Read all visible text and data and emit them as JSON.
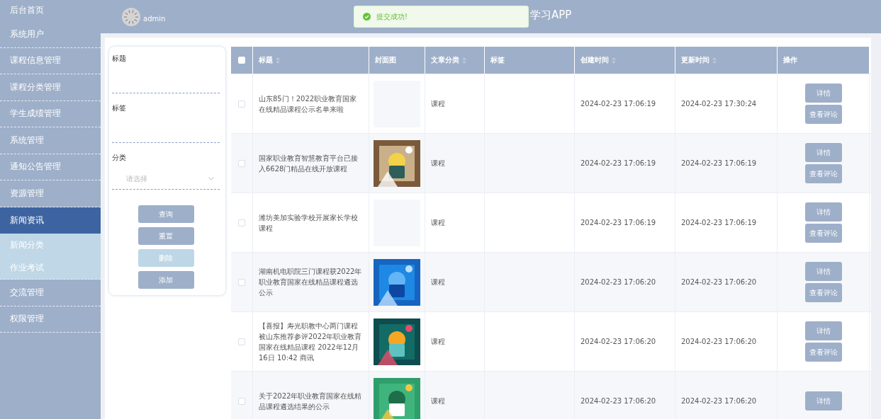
{
  "sidebar": {
    "items": [
      {
        "label": "后台首页",
        "selected": false
      },
      {
        "label": "系统用户",
        "selected": false
      },
      {
        "label": "课程信息管理",
        "selected": false
      },
      {
        "label": "课程分类管理",
        "selected": false
      },
      {
        "label": "学生成绩管理",
        "selected": false
      },
      {
        "label": "系统管理",
        "selected": false
      },
      {
        "label": "通知公告管理",
        "selected": false
      },
      {
        "label": "资源管理",
        "selected": false
      },
      {
        "label": "新闻资讯",
        "selected": true,
        "expanded": true,
        "children": [
          {
            "label": "新闻分类",
            "selected": false
          },
          {
            "label": "作业考试",
            "selected": false
          }
        ]
      },
      {
        "label": "交流管理",
        "selected": false
      },
      {
        "label": "权限管理",
        "selected": false
      }
    ]
  },
  "header": {
    "user": "admin",
    "title": "学习APP"
  },
  "toast": {
    "text": "提交成功!"
  },
  "filter": {
    "fields": [
      {
        "kind": "input",
        "label": "标题"
      },
      {
        "kind": "input",
        "label": "标签"
      },
      {
        "kind": "select",
        "label": "分类",
        "placeholder": "请选择"
      }
    ],
    "buttons": [
      {
        "label": "查询",
        "disabled": false
      },
      {
        "label": "重置",
        "disabled": false
      },
      {
        "label": "删除",
        "disabled": true
      },
      {
        "label": "添加",
        "disabled": false
      }
    ]
  },
  "table": {
    "select_all": {
      "checked": false
    },
    "columns": [
      {
        "label": "标题",
        "sortable": true
      },
      {
        "label": "封面图",
        "sortable": false
      },
      {
        "label": "文章分类",
        "sortable": true
      },
      {
        "label": "标签",
        "sortable": false
      },
      {
        "label": "创建时间",
        "sortable": true
      },
      {
        "label": "更新时间",
        "sortable": true
      },
      {
        "label": "操作",
        "sortable": false
      }
    ],
    "rows": [
      {
        "checked": false,
        "title": "山东85门！2022职业教育国家在线精品课程公示名单来啦",
        "cover": {
          "kind": "empty"
        },
        "category": "课程",
        "created": "2024-02-23 17:06:19",
        "updated": "2024-02-23 17:30:24",
        "actions": [
          "详情",
          "查看评论"
        ]
      },
      {
        "checked": false,
        "title": "国家职业教育智慧教育平台已接入6628门精品在线开放课程",
        "cover": {
          "kind": "picture"
        },
        "category": "课程",
        "created": "2024-02-23 17:06:19",
        "updated": "2024-02-23 17:06:19",
        "actions": [
          "详情",
          "查看评论"
        ]
      },
      {
        "checked": false,
        "title": "潍坊美加实验学校开展家长学校课程",
        "cover": {
          "kind": "empty"
        },
        "category": "课程",
        "created": "2024-02-23 17:06:19",
        "updated": "2024-02-23 17:06:19",
        "actions": [
          "详情",
          "查看评论"
        ]
      },
      {
        "checked": false,
        "title": "湖南机电职院三门课程获2022年职业教育国家在线精品课程遴选公示",
        "cover": {
          "kind": "picture"
        },
        "category": "课程",
        "created": "2024-02-23 17:06:20",
        "updated": "2024-02-23 17:06:20",
        "actions": [
          "详情",
          "查看评论"
        ]
      },
      {
        "checked": false,
        "title": "【喜报】寿光职教中心两门课程被山东推荐参评2022年职业教育国家在线精品课程 2022年12月16日 10:42 商讯",
        "cover": {
          "kind": "picture"
        },
        "category": "课程",
        "created": "2024-02-23 17:06:20",
        "updated": "2024-02-23 17:06:20",
        "actions": [
          "详情",
          "查看评论"
        ]
      },
      {
        "checked": false,
        "title": "关于2022年职业教育国家在线精品课程遴选结果的公示",
        "cover": {
          "kind": "picture"
        },
        "category": "课程",
        "created": "2024-02-23 17:06:20",
        "updated": "2024-02-23 17:06:20",
        "actions": [
          "详情"
        ]
      }
    ]
  }
}
